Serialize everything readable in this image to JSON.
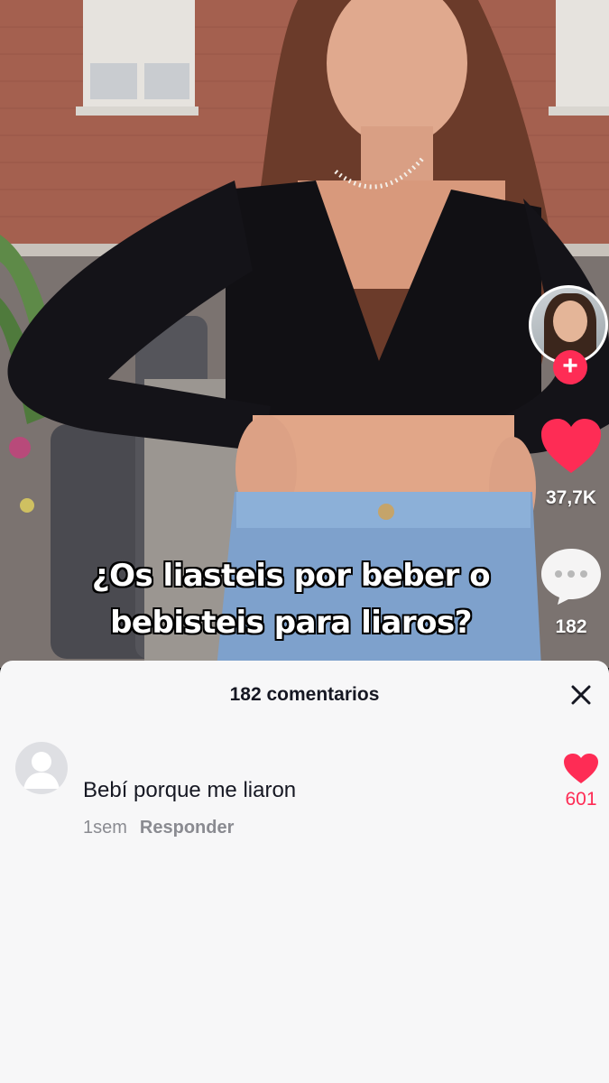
{
  "video": {
    "caption_line1": "¿Os liasteis por beber o",
    "caption_line2": "bebisteis para liaros?"
  },
  "rail": {
    "avatar_icon": "creator-avatar",
    "follow_icon": "plus-icon",
    "like_count": "37,7K",
    "comment_count": "182"
  },
  "comments_sheet": {
    "title": "182 comentarios",
    "close_icon": "close-icon",
    "comments": [
      {
        "text": "Bebí porque me liaron",
        "time": "1sem",
        "reply_label": "Responder",
        "likes": "601"
      }
    ]
  },
  "colors": {
    "accent": "#fe2c55",
    "sheet_bg": "#f7f7f8",
    "text_primary": "#161823",
    "text_secondary": "#8a8b91"
  }
}
